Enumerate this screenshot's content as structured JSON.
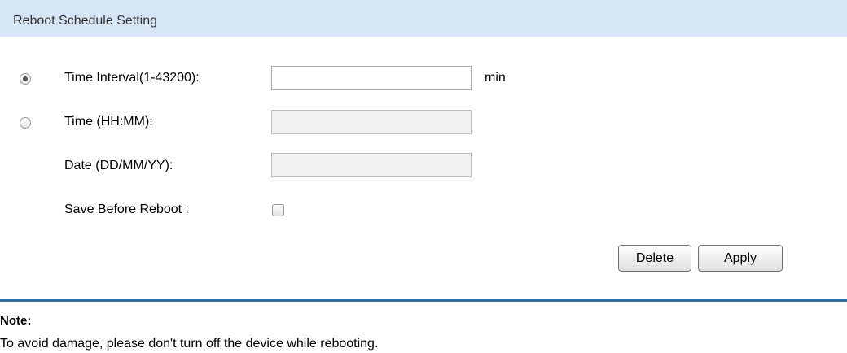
{
  "header": {
    "title": "Reboot Schedule Setting"
  },
  "form": {
    "time_interval": {
      "label": "Time Interval(1-43200):",
      "value": "",
      "unit": "min",
      "selected": true
    },
    "time": {
      "label": "Time (HH:MM):",
      "value": "",
      "selected": false
    },
    "date": {
      "label": "Date (DD/MM/YY):",
      "value": ""
    },
    "save_before_reboot": {
      "label": "Save Before Reboot :",
      "checked": false
    }
  },
  "buttons": {
    "delete_label": "Delete",
    "apply_label": "Apply"
  },
  "note": {
    "title": "Note:",
    "text": "To avoid damage, please don't turn off the device while rebooting."
  },
  "colors": {
    "header_bg": "#d7e6f7",
    "divider": "#2f6da3"
  }
}
